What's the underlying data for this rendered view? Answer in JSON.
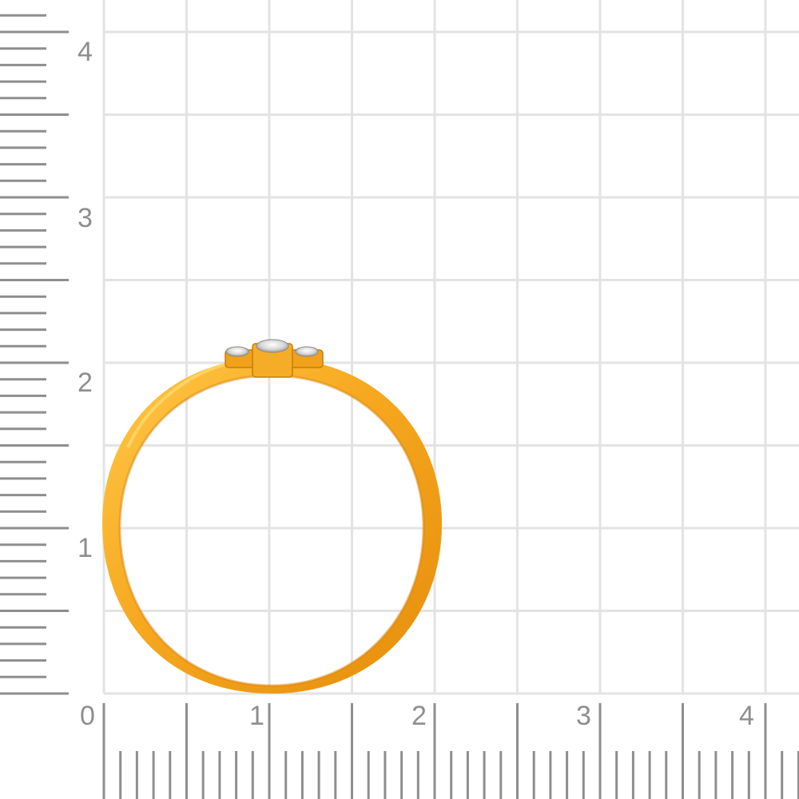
{
  "scale": {
    "y_labels": [
      "1",
      "2",
      "3",
      "4"
    ],
    "x_labels": [
      "0",
      "1",
      "2",
      "3",
      "4"
    ]
  },
  "colors": {
    "grid": "#e3e3e3",
    "ruler": "#8e8e8e",
    "gold": "#f2a31a",
    "gold_dark": "#e08a0a",
    "gold_light": "#ffc94a"
  }
}
